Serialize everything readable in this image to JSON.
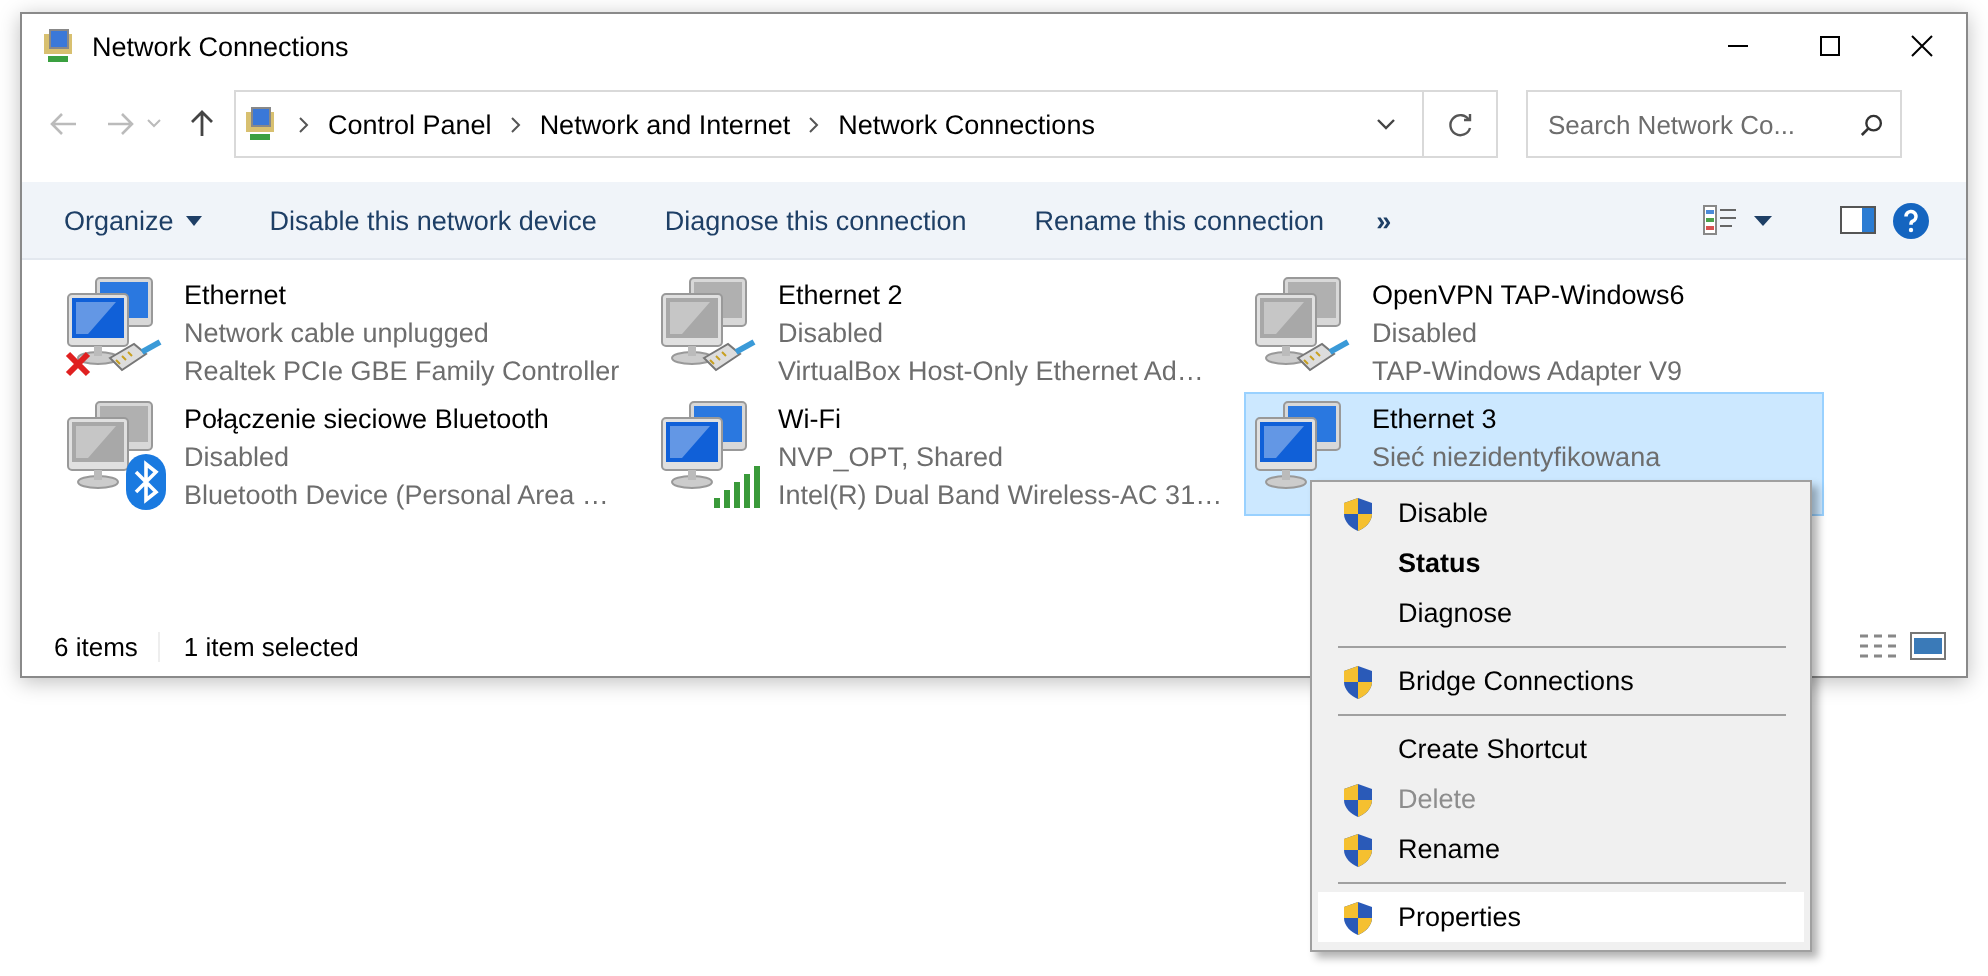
{
  "window": {
    "title": "Network Connections"
  },
  "address": {
    "path": [
      "Control Panel",
      "Network and Internet",
      "Network Connections"
    ]
  },
  "search": {
    "placeholder": "Search Network Co..."
  },
  "toolbar": {
    "items": [
      "Organize",
      "Disable this network device",
      "Diagnose this connection",
      "Rename this connection"
    ],
    "more": "»"
  },
  "connections": [
    {
      "name": "Ethernet",
      "status": "Network cable unplugged",
      "adapter": "Realtek PCIe GBE Family Controller",
      "enabled": true,
      "kind": "unplugged",
      "selected": false
    },
    {
      "name": "Ethernet 2",
      "status": "Disabled",
      "adapter": "VirtualBox Host-Only Ethernet Ad…",
      "enabled": false,
      "kind": "cable",
      "selected": false
    },
    {
      "name": "OpenVPN TAP-Windows6",
      "status": "Disabled",
      "adapter": "TAP-Windows Adapter V9",
      "enabled": false,
      "kind": "cable",
      "selected": false
    },
    {
      "name": "Połączenie sieciowe Bluetooth",
      "status": "Disabled",
      "adapter": "Bluetooth Device (Personal Area …",
      "enabled": false,
      "kind": "bluetooth",
      "selected": false
    },
    {
      "name": "Wi-Fi",
      "status": "NVP_OPT, Shared",
      "adapter": "Intel(R) Dual Band Wireless-AC 31…",
      "enabled": true,
      "kind": "signal",
      "selected": false
    },
    {
      "name": "Ethernet 3",
      "status": "Sieć niezidentyfikowana",
      "enabled": true,
      "kind": "hidden",
      "selected": true
    }
  ],
  "status_bar": {
    "count": "6 items",
    "selection": "1 item selected"
  },
  "context_menu": [
    {
      "kind": "item",
      "label": "Disable",
      "shield": true,
      "bold": false,
      "disabled": false,
      "selected": false
    },
    {
      "kind": "item",
      "label": "Status",
      "shield": false,
      "bold": true,
      "disabled": false,
      "selected": false
    },
    {
      "kind": "item",
      "label": "Diagnose",
      "shield": false,
      "bold": false,
      "disabled": false,
      "selected": false
    },
    {
      "kind": "separator"
    },
    {
      "kind": "item",
      "label": "Bridge Connections",
      "shield": true,
      "bold": false,
      "disabled": false,
      "selected": false
    },
    {
      "kind": "separator"
    },
    {
      "kind": "item",
      "label": "Create Shortcut",
      "shield": false,
      "bold": false,
      "disabled": false,
      "selected": false
    },
    {
      "kind": "item",
      "label": "Delete",
      "shield": true,
      "bold": false,
      "disabled": true,
      "selected": false
    },
    {
      "kind": "item",
      "label": "Rename",
      "shield": true,
      "bold": false,
      "disabled": false,
      "selected": false
    },
    {
      "kind": "separator"
    },
    {
      "kind": "item",
      "label": "Properties",
      "shield": true,
      "bold": false,
      "disabled": false,
      "selected": true
    }
  ]
}
